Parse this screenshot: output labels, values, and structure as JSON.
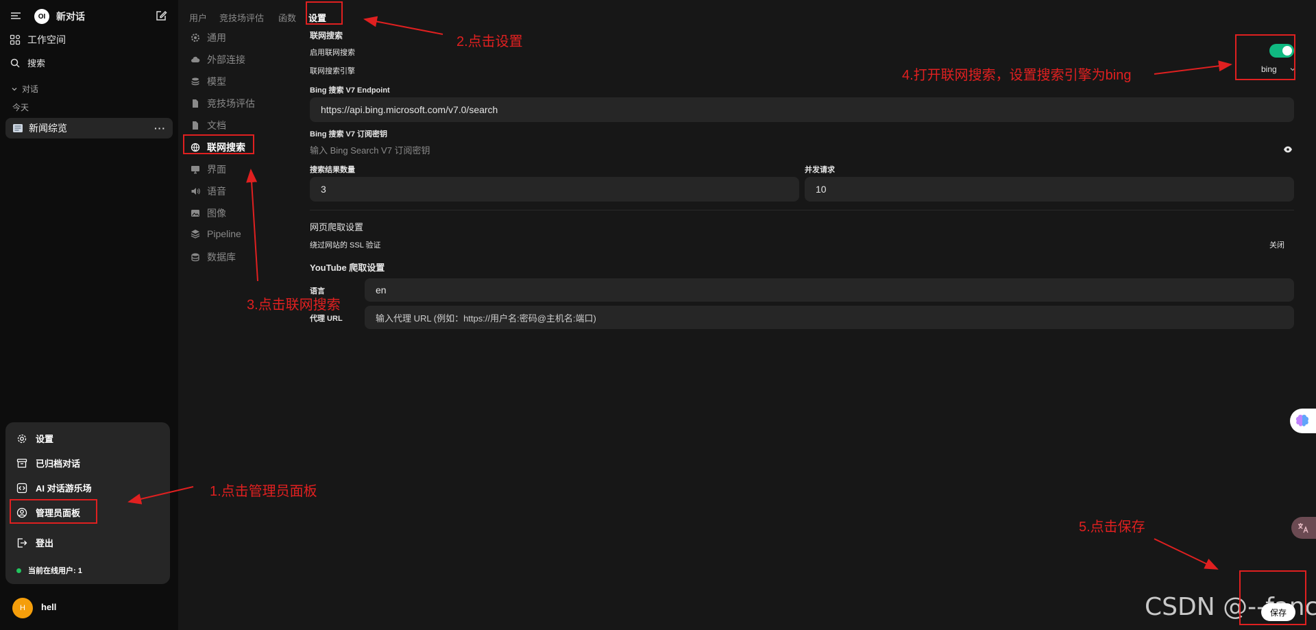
{
  "sidebar": {
    "new_chat": "新对话",
    "logo_text": "OI",
    "workspace": "工作空间",
    "search": "搜索",
    "section_chats": "对话",
    "group_today": "今天",
    "chat_items": [
      {
        "title": "新闻综览"
      }
    ],
    "chat_more": "···",
    "user_menu": {
      "settings": "设置",
      "archived": "已归档对话",
      "playground": "AI 对话游乐场",
      "admin_panel": "管理员面板",
      "logout": "登出",
      "online": "当前在线用户: 1"
    },
    "user": {
      "initial": "H",
      "name": "hell"
    }
  },
  "admin_tabs": [
    "用户",
    "竞技场评估",
    "函数",
    "设置"
  ],
  "settings_menu": [
    {
      "label": "通用",
      "icon": "gear-icon"
    },
    {
      "label": "外部连接",
      "icon": "cloud-icon"
    },
    {
      "label": "模型",
      "icon": "cube-stack-icon"
    },
    {
      "label": "竞技场评估",
      "icon": "document-icon"
    },
    {
      "label": "文档",
      "icon": "document-icon"
    },
    {
      "label": "联网搜索",
      "icon": "globe-icon"
    },
    {
      "label": "界面",
      "icon": "monitor-icon"
    },
    {
      "label": "语音",
      "icon": "speaker-icon"
    },
    {
      "label": "图像",
      "icon": "image-icon"
    },
    {
      "label": "Pipeline",
      "icon": "layers-icon"
    },
    {
      "label": "数据库",
      "icon": "database-icon"
    }
  ],
  "web_search": {
    "section_title": "联网搜索",
    "enable_label": "启用联网搜索",
    "enabled": true,
    "engine_label": "联网搜索引擎",
    "engine_value": "bing",
    "endpoint_label": "Bing 搜索 V7 Endpoint",
    "endpoint_value": "https://api.bing.microsoft.com/v7.0/search",
    "key_label": "Bing 搜索 V7 订阅密钥",
    "key_placeholder": "输入 Bing Search V7 订阅密钥",
    "result_count_label": "搜索结果数量",
    "result_count_value": "3",
    "concurrent_label": "并发请求",
    "concurrent_value": "10",
    "crawl_section": "网页爬取设置",
    "ssl_label": "绕过网站的 SSL 验证",
    "ssl_value": "关闭",
    "youtube_section": "YouTube 爬取设置",
    "language_label": "语言",
    "language_value": "en",
    "proxy_label": "代理 URL",
    "proxy_placeholder": "输入代理 URL (例如：https://用户名:密码@主机名:端口)"
  },
  "save_label": "保存",
  "annotations": {
    "step1": "1.点击管理员面板",
    "step2": "2.点击设置",
    "step3": "3.点击联网搜索",
    "step4": "4.打开联网搜索，设置搜索引擎为bing",
    "step5": "5.点击保存"
  },
  "watermark": "CSDN @--fancy",
  "colors": {
    "annotation": "#e02020",
    "toggle_on": "#10b981",
    "online": "#22c55e",
    "avatar": "#f59e0b"
  }
}
